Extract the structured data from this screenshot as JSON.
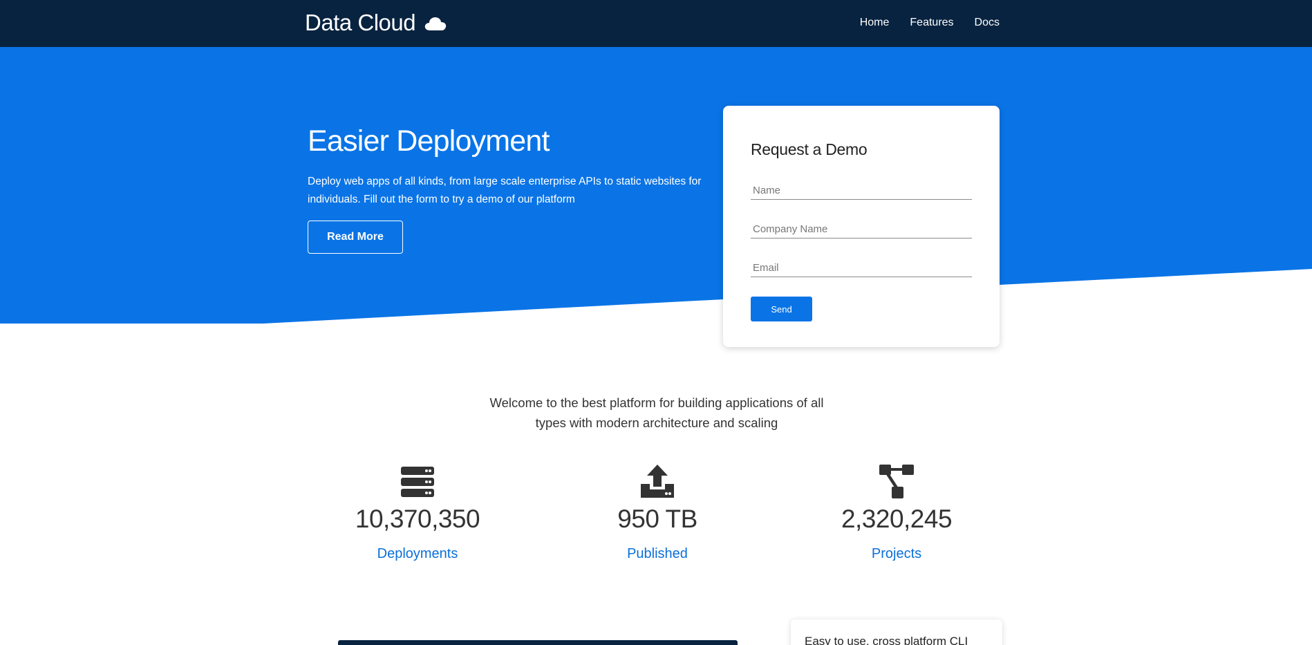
{
  "brand": {
    "name": "Data Cloud",
    "icon": "cloud-icon"
  },
  "nav": {
    "items": [
      {
        "label": "Home"
      },
      {
        "label": "Features"
      },
      {
        "label": "Docs"
      }
    ]
  },
  "hero": {
    "title": "Easier Deployment",
    "description": "Deploy web apps of all kinds, from large scale enterprise APIs to static websites for individuals. Fill out the form to try a demo of our platform",
    "read_more_label": "Read More"
  },
  "demo_form": {
    "title": "Request a Demo",
    "name_placeholder": "Name",
    "company_placeholder": "Company Name",
    "email_placeholder": "Email",
    "send_label": "Send"
  },
  "welcome": "Welcome to the best platform for building applications of all types with modern architecture and scaling",
  "stats": [
    {
      "icon": "server-icon",
      "value": "10,370,350",
      "label": "Deployments"
    },
    {
      "icon": "upload-icon",
      "value": "950 TB",
      "label": "Published"
    },
    {
      "icon": "sitemap-icon",
      "value": "2,320,245",
      "label": "Projects"
    }
  ],
  "feature_card": {
    "text": "Easy to use, cross platform CLI"
  },
  "colors": {
    "navbar": "#082340",
    "hero": "#0a74e6",
    "accent": "#0a6fd8",
    "text": "#333333"
  }
}
